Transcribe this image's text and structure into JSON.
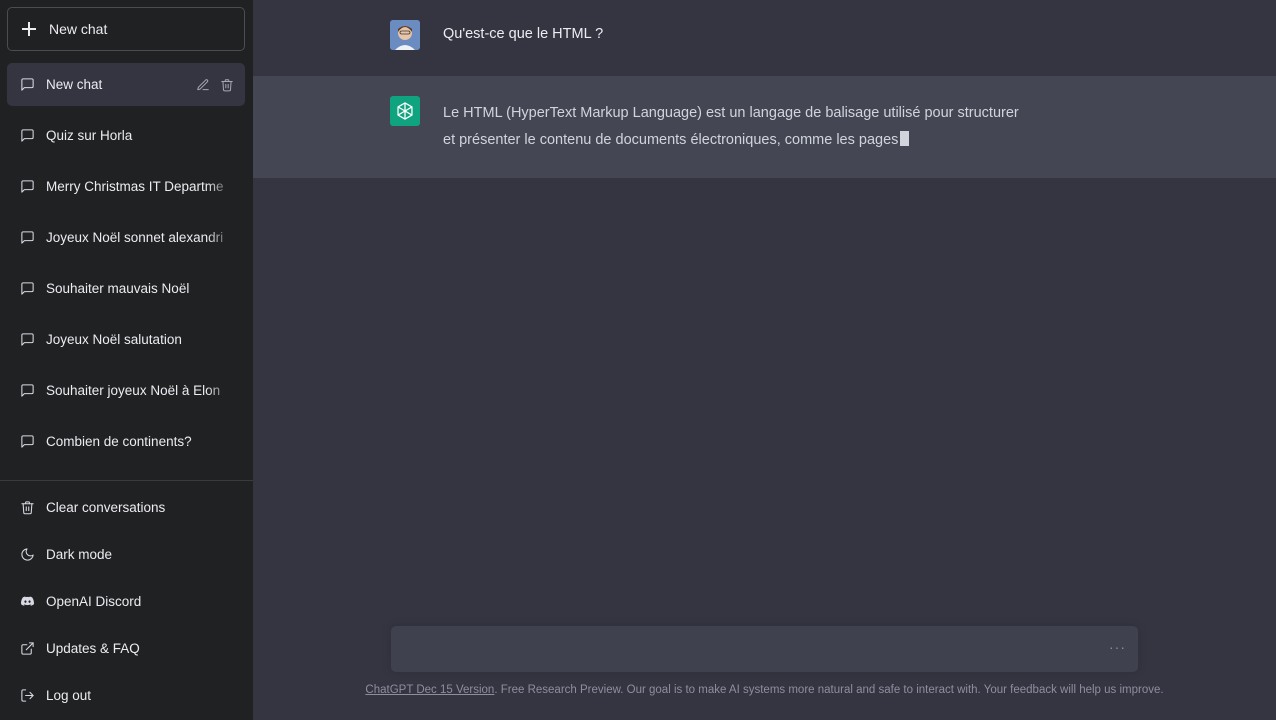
{
  "sidebar": {
    "new_chat_label": "New chat",
    "conversations": [
      {
        "label": "New chat",
        "active": true
      },
      {
        "label": "Quiz sur Horla"
      },
      {
        "label": "Merry Christmas IT Departme"
      },
      {
        "label": "Joyeux Noël sonnet alexandri"
      },
      {
        "label": "Souhaiter mauvais Noël"
      },
      {
        "label": "Joyeux Noël salutation"
      },
      {
        "label": "Souhaiter joyeux Noël à Elon"
      },
      {
        "label": "Combien de continents?"
      }
    ],
    "menu": [
      {
        "label": "Clear conversations",
        "icon": "trash-icon"
      },
      {
        "label": "Dark mode",
        "icon": "moon-icon"
      },
      {
        "label": "OpenAI Discord",
        "icon": "discord-icon"
      },
      {
        "label": "Updates & FAQ",
        "icon": "external-link-icon"
      },
      {
        "label": "Log out",
        "icon": "logout-icon"
      }
    ]
  },
  "thread": {
    "user_message": "Qu'est-ce que le HTML ?",
    "assistant_message_line1": "Le HTML (HyperText Markup Language) est un langage de balisage utilisé pour structurer",
    "assistant_message_line2": "et présenter le contenu de documents électroniques, comme les pages"
  },
  "composer": {
    "placeholder": "",
    "status_indicator": "···"
  },
  "footer": {
    "version_link": "ChatGPT Dec 15 Version",
    "note": ". Free Research Preview. Our goal is to make AI systems more natural and safe to interact with. Your feedback will help us improve."
  },
  "colors": {
    "sidebar_bg": "#202123",
    "main_bg": "#343541",
    "assistant_row_bg": "#444654",
    "bot_avatar": "#10a37f"
  }
}
